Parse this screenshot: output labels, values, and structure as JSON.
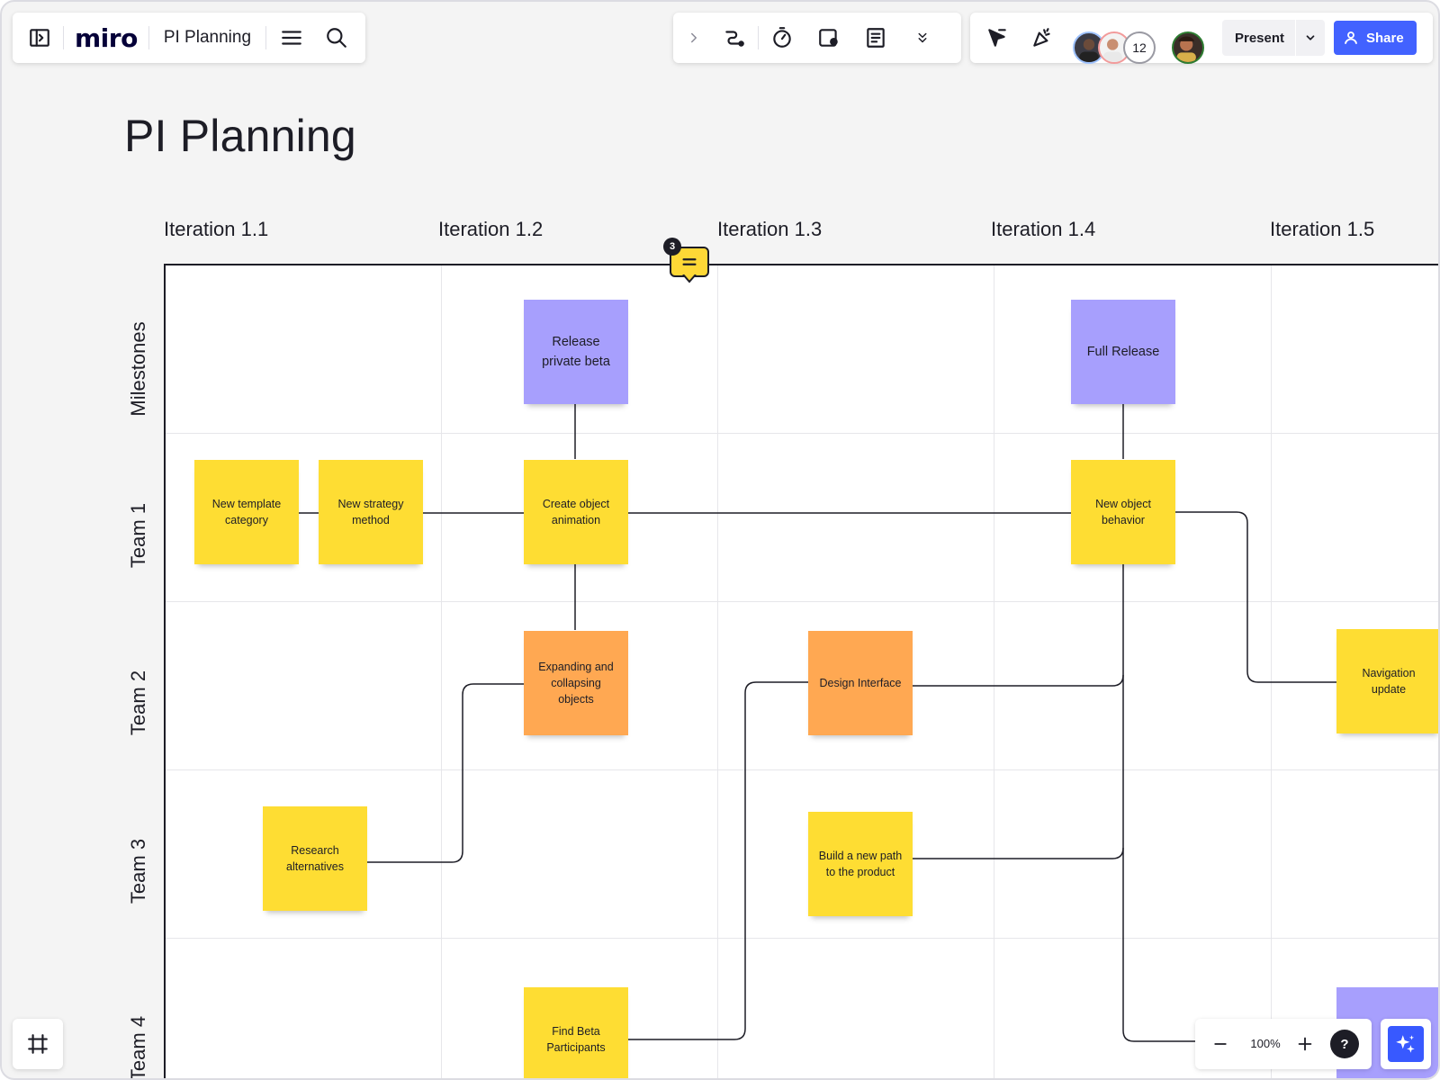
{
  "app": {
    "brand": "miro",
    "board_name": "PI Planning"
  },
  "toolbar": {
    "present_label": "Present",
    "share_label": "Share",
    "collaborator_count": "12"
  },
  "board": {
    "title": "PI Planning",
    "iterations": [
      "Iteration 1.1",
      "Iteration 1.2",
      "Iteration 1.3",
      "Iteration 1.4",
      "Iteration 1.5"
    ],
    "rows": [
      "Milestones",
      "Team 1",
      "Team 2",
      "Team 3",
      "Team 4"
    ]
  },
  "stickies": {
    "release_private_beta": "Release private beta",
    "full_release": "Full Release",
    "new_template_category": "New template category",
    "new_strategy_method": "New strategy method",
    "create_object_animation": "Create object animation",
    "new_object_behavior": "New object behavior",
    "expanding_collapsing": "Expanding and collapsing objects",
    "design_interface": "Design Interface",
    "navigation_update": "Navigation update",
    "research_alternatives": "Research alternatives",
    "build_new_path": "Build a new path to the product",
    "find_beta_participants": "Find Beta Participants"
  },
  "comment": {
    "count": "3"
  },
  "zoom": {
    "level": "100%",
    "help": "?"
  },
  "colors": {
    "sticky_yellow": "#fedd33",
    "sticky_orange": "#ffa852",
    "sticky_purple": "#a79ffd",
    "share_blue": "#4262ff",
    "ai_blue": "#3859ff"
  },
  "icons": [
    "sidebar-toggle-icon",
    "menu-icon",
    "search-icon",
    "chevron-right-icon",
    "connector-icon",
    "timer-icon",
    "sticky-note-add-icon",
    "notes-icon",
    "more-tools-icon",
    "cursor-reaction-icon",
    "celebrate-icon",
    "chevron-down-icon",
    "user-icon",
    "frames-icon",
    "zoom-out-icon",
    "zoom-in-icon",
    "help-icon",
    "ai-sparkle-icon",
    "comment-icon"
  ]
}
